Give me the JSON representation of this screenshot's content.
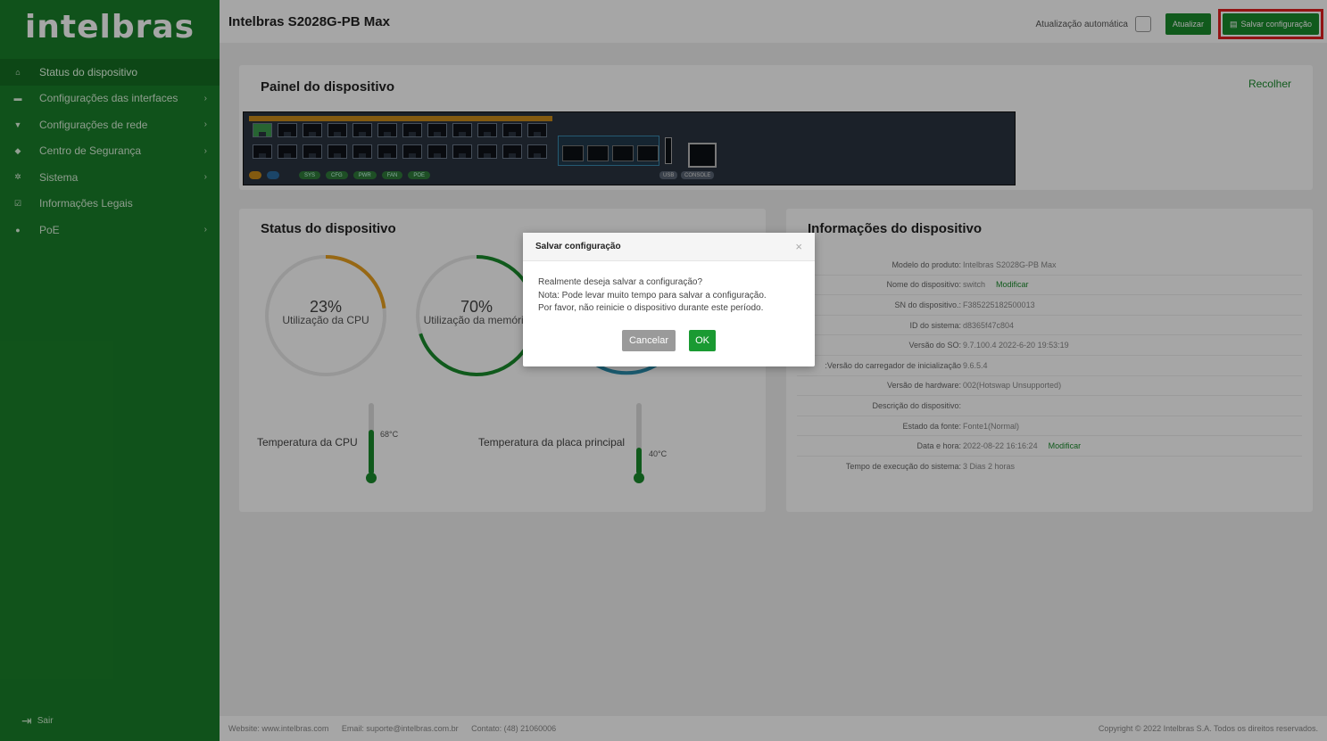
{
  "app": {
    "logo": "intelbras",
    "title": "Intelbras S2028G-PB Max"
  },
  "header": {
    "auto_update_label": "Atualização automática",
    "refresh_label": "Atualizar",
    "save_label": "Salvar configuração"
  },
  "sidebar": {
    "items": [
      {
        "label": "Status do dispositivo",
        "icon": "home-icon",
        "active": true
      },
      {
        "label": "Configurações das interfaces",
        "icon": "interfaces-icon"
      },
      {
        "label": "Configurações de rede",
        "icon": "network-icon"
      },
      {
        "label": "Centro de Segurança",
        "icon": "shield-icon"
      },
      {
        "label": "Sistema",
        "icon": "gear-icon"
      },
      {
        "label": "Informações Legais",
        "icon": "check-icon"
      },
      {
        "label": "PoE",
        "icon": "poe-icon"
      }
    ],
    "logout_label": "Sair"
  },
  "panel": {
    "title": "Painel do dispositivo",
    "collapse_label": "Recolher",
    "led_labels": [
      "SYS",
      "CFG",
      "PWR",
      "FAN",
      "POE"
    ],
    "usb_label": "USB",
    "console_label": "CONSOLE"
  },
  "status": {
    "title": "Status do dispositivo",
    "cpu_pct": "23%",
    "cpu_label": "Utilização da CPU",
    "cpu_value": 0.23,
    "mem_pct": "70%",
    "mem_label": "Utilização da memória",
    "mem_value": 0.7,
    "cpu_temp_label": "Temperatura da CPU",
    "cpu_temp": "68°C",
    "board_temp_label": "Temperatura da placa principal",
    "board_temp": "40°C"
  },
  "info": {
    "title": "Informações do dispositivo",
    "rows": [
      {
        "key": "Modelo do produto:",
        "value": "Intelbras S2028G-PB Max"
      },
      {
        "key": "Nome do dispositivo:",
        "value": "switch",
        "link": "Modificar"
      },
      {
        "key": "SN do dispositivo.:",
        "value": "F385225182500013"
      },
      {
        "key": "ID do sistema:",
        "value": "d8365f47c804"
      },
      {
        "key": "Versão do SO:",
        "value": "9.7.100.4 2022-6-20 19:53:19"
      },
      {
        "key": "Versão do carregador de inicialização:",
        "value": "9.6.5.4"
      },
      {
        "key": "Versão de hardware:",
        "value": "002(Hotswap Unsupported)"
      },
      {
        "key": "Descrição do dispositivo:",
        "value": ""
      },
      {
        "key": "Estado da fonte:",
        "value": "Fonte1(Normal)"
      },
      {
        "key": "Data e hora:",
        "value": "2022-08-22 16:16:24",
        "link": "Modificar"
      },
      {
        "key": "Tempo de execução do sistema:",
        "value": "3 Dias 2 horas"
      }
    ]
  },
  "footer": {
    "website": "Website: www.intelbras.com",
    "email": "Email: suporte@intelbras.com.br",
    "contact": "Contato: (48) 21060006",
    "copyright": "Copyright © 2022 Intelbras S.A. Todos os direitos reservados."
  },
  "modal": {
    "title": "Salvar configuração",
    "line1": "Realmente deseja salvar a configuração?",
    "line2": "Nota: Pode levar muito tempo para salvar a configuração.",
    "line3": "Por favor, não reinicie o dispositivo durante este período.",
    "cancel_label": "Cancelar",
    "ok_label": "OK",
    "close_symbol": "×"
  }
}
